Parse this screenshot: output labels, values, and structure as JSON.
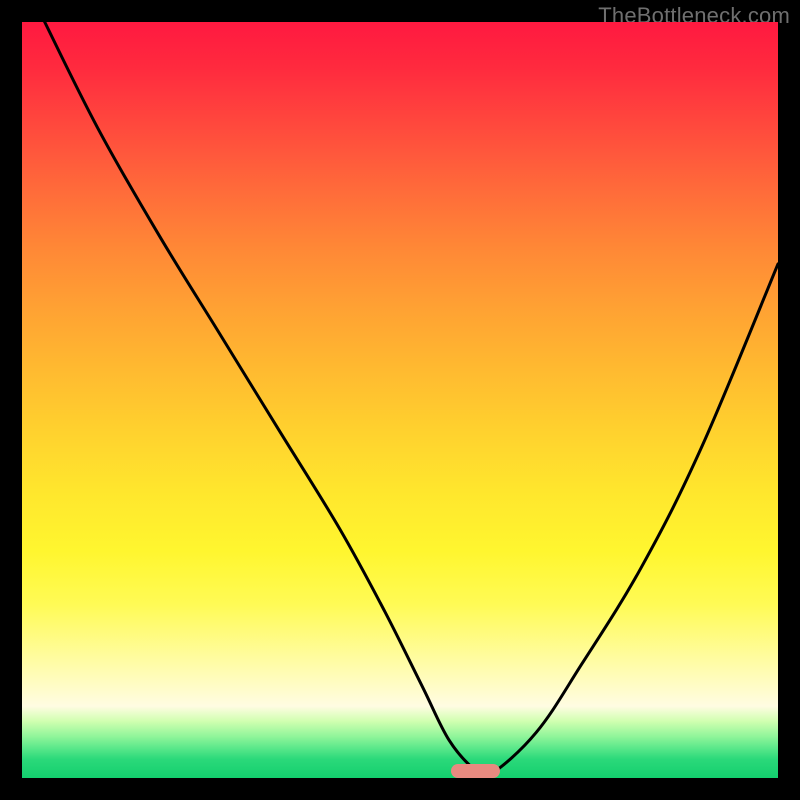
{
  "watermark": {
    "text": "TheBottleneck.com"
  },
  "chart_data": {
    "type": "line",
    "title": "",
    "xlabel": "",
    "ylabel": "",
    "xlim": [
      0,
      100
    ],
    "ylim": [
      0,
      100
    ],
    "grid": false,
    "legend": false,
    "series": [
      {
        "name": "bottleneck-curve",
        "x": [
          3,
          10,
          18,
          26,
          34,
          42,
          48,
          53,
          56.5,
          60,
          62,
          68,
          74,
          82,
          90,
          100
        ],
        "values": [
          100,
          86,
          72,
          59,
          46,
          33,
          22,
          12,
          5,
          1,
          0.5,
          6,
          15,
          28,
          44,
          68
        ]
      }
    ],
    "marker": {
      "x_center_pct": 60,
      "width_pct": 6.5,
      "color": "#e88a80"
    },
    "background_gradient": {
      "top": "#ff1940",
      "mid": "#ffe62d",
      "bottom": "#13cf6e"
    }
  }
}
